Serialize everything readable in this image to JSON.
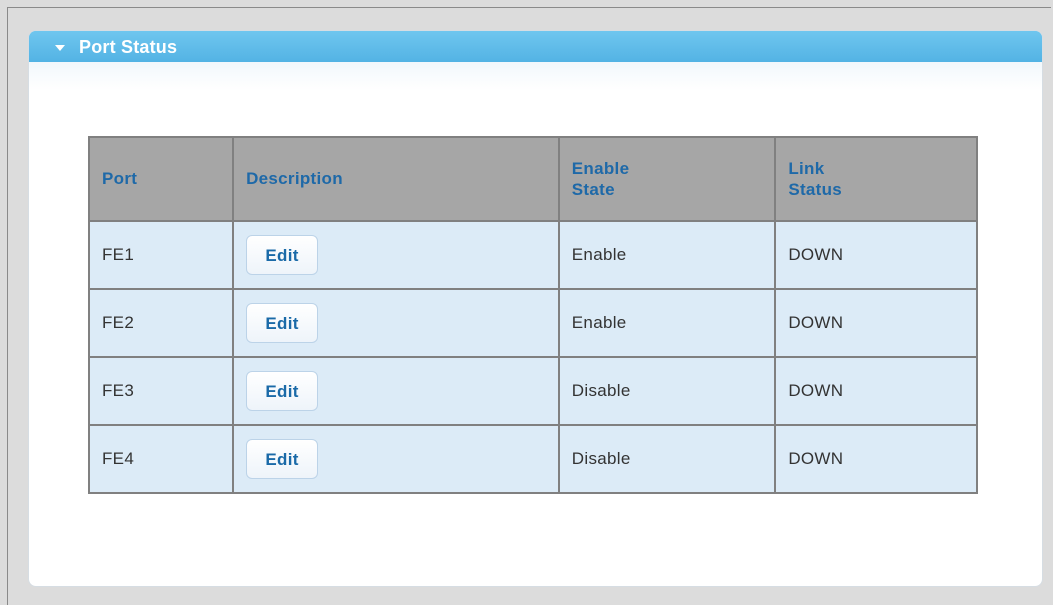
{
  "panel": {
    "title": "Port Status"
  },
  "table": {
    "headers": {
      "port": "Port",
      "description": "Description",
      "enable_state_line1": "Enable",
      "enable_state_line2": "State",
      "link_status_line1": "Link",
      "link_status_line2": "Status"
    },
    "rows": [
      {
        "port": "FE1",
        "edit_label": "Edit",
        "enable_state": "Enable",
        "link_status": "DOWN"
      },
      {
        "port": "FE2",
        "edit_label": "Edit",
        "enable_state": "Enable",
        "link_status": "DOWN"
      },
      {
        "port": "FE3",
        "edit_label": "Edit",
        "enable_state": "Disable",
        "link_status": "DOWN"
      },
      {
        "port": "FE4",
        "edit_label": "Edit",
        "enable_state": "Disable",
        "link_status": "DOWN"
      }
    ]
  },
  "icons": {
    "collapse": "collapse-triangle-icon"
  },
  "colors": {
    "header_band": "#5ab9e7",
    "table_header_bg": "#a6a6a6",
    "table_header_text": "#1e69a8",
    "row_bg": "#dcebf7",
    "edit_text": "#1a6aa8"
  }
}
